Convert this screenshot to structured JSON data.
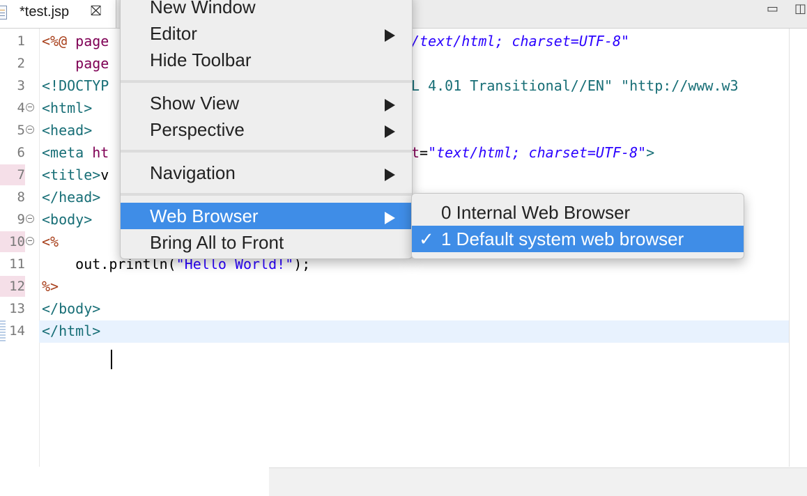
{
  "tab": {
    "title": "*test.jsp",
    "close_glyph": "⛝"
  },
  "window_buttons": {
    "minimize": "▭",
    "maximize": "◫"
  },
  "editor": {
    "lines": [
      {
        "n": "1",
        "parts": [
          [
            "jsp",
            "<%@ "
          ],
          [
            "kw",
            "page"
          ]
        ]
      },
      {
        "n": "2",
        "parts": [
          [
            "kw",
            "    page"
          ]
        ]
      },
      {
        "n": "3",
        "parts": [
          [
            "tag",
            "<!DOCTYP"
          ]
        ]
      },
      {
        "n": "4",
        "parts": [
          [
            "tag",
            "<html>"
          ]
        ],
        "fold": true
      },
      {
        "n": "5",
        "parts": [
          [
            "tag",
            "<head>"
          ]
        ],
        "fold": true
      },
      {
        "n": "6",
        "parts": [
          [
            "tag",
            "<meta "
          ],
          [
            "kw",
            "ht"
          ]
        ]
      },
      {
        "n": "7",
        "parts": [
          [
            "tag",
            "<title>"
          ],
          [
            "txt",
            "v"
          ]
        ]
      },
      {
        "n": "8",
        "parts": [
          [
            "tag",
            "</head>"
          ]
        ]
      },
      {
        "n": "9",
        "parts": [
          [
            "tag",
            "<body>"
          ]
        ],
        "fold": true
      },
      {
        "n": "10",
        "parts": [
          [
            "jsp",
            "<%"
          ]
        ],
        "fold": true
      },
      {
        "n": "11",
        "parts": [
          [
            "txt",
            "    out.println("
          ],
          [
            "strn",
            "\"Hello World!\""
          ],
          [
            "txt",
            ");"
          ]
        ]
      },
      {
        "n": "12",
        "parts": [
          [
            "jsp",
            "%>"
          ]
        ]
      },
      {
        "n": "13",
        "parts": [
          [
            "tag",
            "</body>"
          ]
        ]
      },
      {
        "n": "14",
        "parts": [
          [
            "tag",
            "</html>"
          ]
        ]
      }
    ],
    "right_fragments": [
      {
        "line": 1,
        "col": "590px",
        "parts": [
          [
            "str",
            "/text/html; charset=UTF-8\""
          ]
        ]
      },
      {
        "line": 3,
        "col": "590px",
        "parts": [
          [
            "tag",
            "L 4.01 Transitional//EN\" \"http://www.w3"
          ]
        ]
      },
      {
        "line": 6,
        "col": "590px",
        "parts": [
          [
            "kw",
            "t"
          ],
          [
            "txt",
            "="
          ],
          [
            "str",
            "\"text/html; charset=UTF-8\""
          ],
          [
            "tag",
            ">"
          ]
        ]
      }
    ]
  },
  "main_menu": {
    "items": [
      {
        "label": "New Window",
        "submenu": false
      },
      {
        "label": "Editor",
        "submenu": true
      },
      {
        "label": "Hide Toolbar",
        "submenu": false
      },
      {
        "sep": true
      },
      {
        "label": "Show View",
        "submenu": true
      },
      {
        "label": "Perspective",
        "submenu": true
      },
      {
        "sep": true
      },
      {
        "label": "Navigation",
        "submenu": true
      },
      {
        "sep": true
      },
      {
        "label": "Web Browser",
        "submenu": true,
        "active": true
      },
      {
        "label": "Bring All to Front",
        "submenu": false
      }
    ]
  },
  "web_browser_submenu": {
    "items": [
      {
        "label": "0 Internal Web Browser",
        "checked": false
      },
      {
        "label": "1 Default system web browser",
        "checked": true,
        "active": true
      }
    ],
    "check_glyph": "✓"
  },
  "colors": {
    "highlight": "#3f8de7",
    "menu_bg": "#eeeeee"
  }
}
